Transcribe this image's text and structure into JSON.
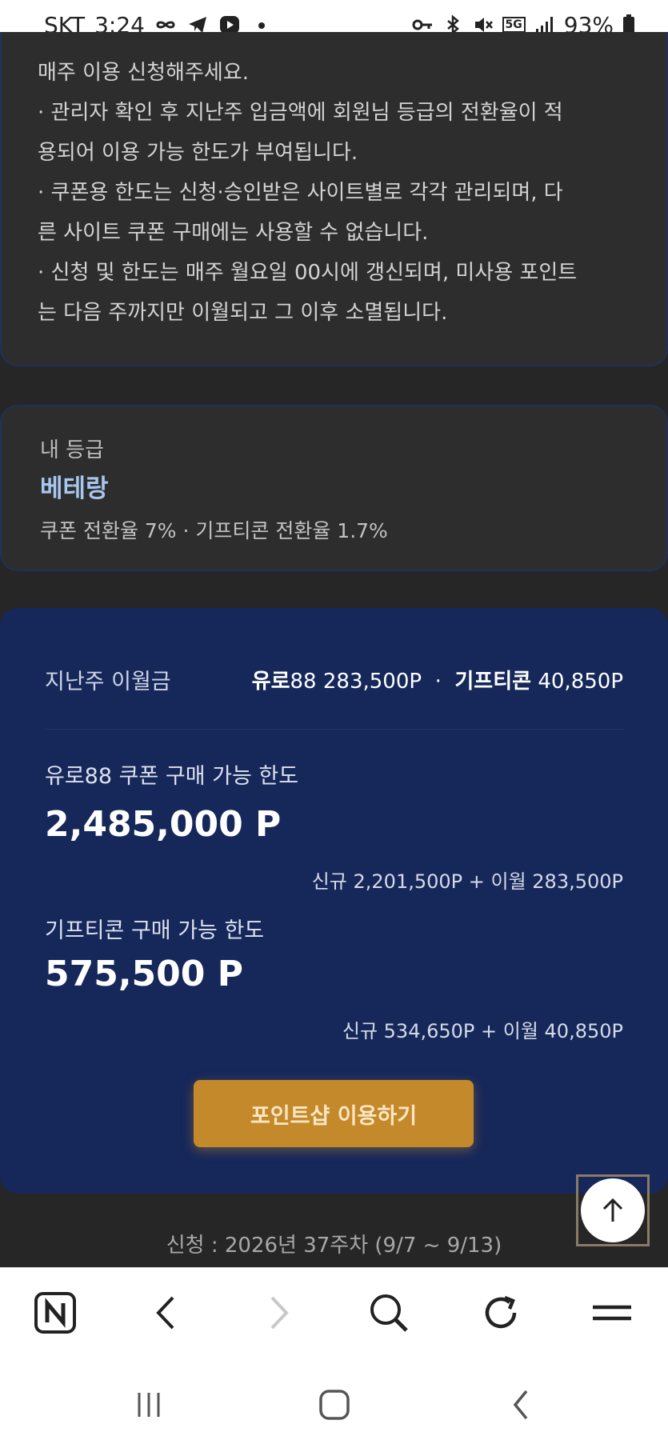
{
  "status_bar": {
    "carrier": "SKT",
    "time": "3:24",
    "network": "5G",
    "battery": "93%",
    "left_icons": [
      "infinity-icon",
      "telegram-icon",
      "media-icon",
      "dot-icon"
    ],
    "right_icons": [
      "key-icon",
      "bluetooth-icon",
      "mute-icon",
      "5g-icon",
      "signal-icon",
      "battery-icon"
    ]
  },
  "notice": {
    "lines": [
      "매주 이용 신청해주세요.",
      "· 관리자 확인 후 지난주 입금액에 회원님 등급의 전환율이 적",
      "용되어 이용 가능 한도가 부여됩니다.",
      "· 쿠폰용 한도는 신청·승인받은 사이트별로 각각 관리되며, 다",
      "른 사이트 쿠폰 구매에는 사용할 수 없습니다.",
      "· 신청 및 한도는 매주 월요일 00시에 갱신되며, 미사용 포인트",
      "는 다음 주까지만 이월되고 그 이후 소멸됩니다."
    ]
  },
  "grade": {
    "label": "내 등급",
    "name": "베테랑",
    "rates": "쿠폰 전환율 7%  ·  기프티콘 전환율 1.7%"
  },
  "points": {
    "carry_label": "지난주 이월금",
    "carry_site_name": "유로",
    "carry_site_value": "88 283,500P",
    "carry_separator": "·",
    "carry_gift_name": "기프티콘",
    "carry_gift_value": "40,850P",
    "coupon_limit_title": "유로88 쿠폰 구매 가능 한도",
    "coupon_limit_amount": "2,485,000 P",
    "coupon_limit_breakdown": "신규 2,201,500P + 이월 283,500P",
    "gift_limit_title": "기프티콘 구매 가능 한도",
    "gift_limit_amount": "575,500 P",
    "gift_limit_breakdown": "신규 534,650P + 이월 40,850P",
    "shop_button": "포인트샵 이용하기"
  },
  "apply_period": "신청 : 2026년 37주차 (9/7 ~ 9/13)",
  "browser_bar": {
    "buttons": [
      "naver-home-icon",
      "back-icon",
      "forward-icon",
      "search-icon",
      "refresh-icon",
      "menu-icon"
    ]
  },
  "nav_bar": {
    "buttons": [
      "recent-apps-icon",
      "home-icon",
      "back-icon"
    ]
  },
  "colors": {
    "background": "#262626",
    "card": "#2d2d2d",
    "points_card": "#16275a",
    "accent_button": "#c4892a",
    "grade_name": "#a7c7ef"
  }
}
